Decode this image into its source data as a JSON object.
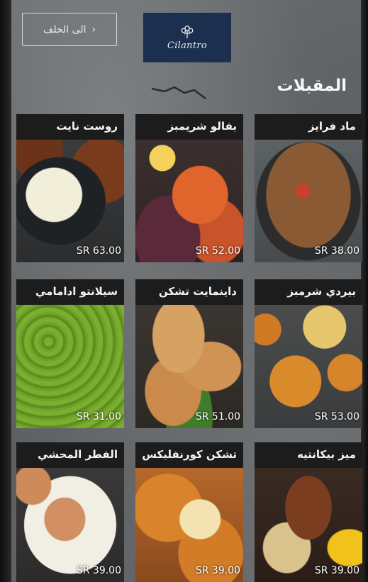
{
  "header": {
    "back_label": "الى الخلف",
    "back_chevron": "›",
    "logo_text": "Cilantro"
  },
  "section_title": "المقبلات",
  "menu_items": [
    {
      "name": "ماد فرايز",
      "price": "SR 38.00"
    },
    {
      "name": "بفالو شريمبز",
      "price": "SR 52.00"
    },
    {
      "name": "روست نايت",
      "price": "SR 63.00"
    },
    {
      "name": "بيردي شرمبز",
      "price": "SR 53.00"
    },
    {
      "name": "داينمايت تشكن",
      "price": "SR 51.00"
    },
    {
      "name": "سيلانتو ادامامي",
      "price": "SR 31.00"
    },
    {
      "name": "ميز بيكانتيه",
      "price": "SR 39.00"
    },
    {
      "name": "تشكن كورنفليكس",
      "price": "SR 39.00"
    },
    {
      "name": "الفطر المحشي",
      "price": "SR 39.00"
    }
  ],
  "colors": {
    "logo_bg": "#1d2f4f",
    "card_header_bg": "#1c1c1c",
    "text": "#f4f4f4"
  }
}
